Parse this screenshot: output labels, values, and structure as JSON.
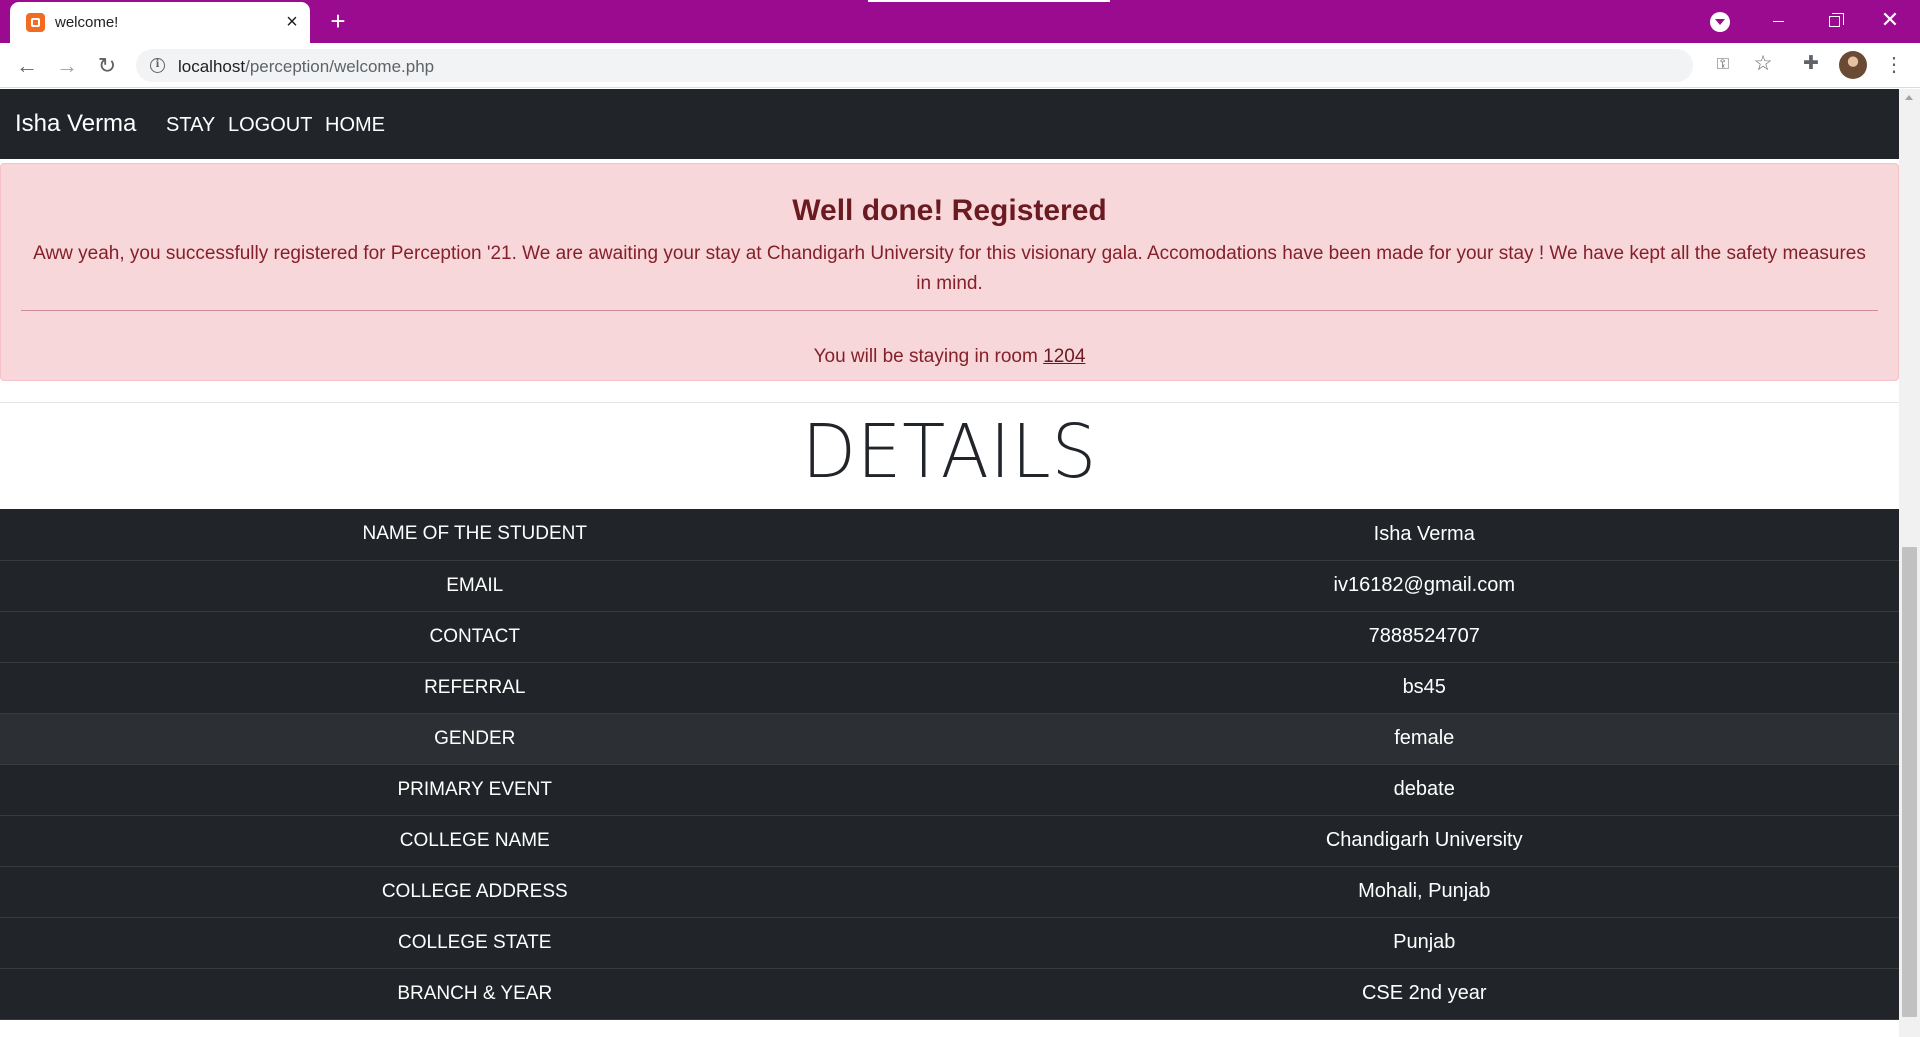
{
  "browser": {
    "tab_title": "welcome!",
    "url_host": "localhost",
    "url_path": "/perception/welcome.php"
  },
  "navbar": {
    "brand": "Isha Verma",
    "links": [
      "STAY",
      "LOGOUT",
      "HOME"
    ]
  },
  "alert": {
    "heading": "Well done! Registered",
    "message": "Aww yeah, you successfully registered for Perception '21. We are awaiting your stay at Chandigarh University for this visionary gala. Accomodations have been made for your stay ! We have kept all the safety measures in mind.",
    "room_prefix": "You will be staying in room",
    "room_number": "1204"
  },
  "details": {
    "heading": "DETAILS",
    "rows": [
      {
        "label": "NAME OF THE STUDENT",
        "value": "Isha Verma"
      },
      {
        "label": "EMAIL",
        "value": "iv16182@gmail.com"
      },
      {
        "label": "CONTACT",
        "value": "7888524707"
      },
      {
        "label": "REFERRAL",
        "value": "bs45"
      },
      {
        "label": "GENDER",
        "value": "female"
      },
      {
        "label": "PRIMARY EVENT",
        "value": "debate"
      },
      {
        "label": "COLLEGE NAME",
        "value": "Chandigarh University"
      },
      {
        "label": "COLLEGE ADDRESS",
        "value": "Mohali, Punjab"
      },
      {
        "label": "COLLEGE STATE",
        "value": "Punjab"
      },
      {
        "label": "BRANCH & YEAR",
        "value": "CSE 2nd year"
      }
    ]
  },
  "colors": {
    "tabstrip": "#9b0b8f",
    "navbar": "#212529",
    "alert_bg": "#f8d7da",
    "alert_text": "#842029"
  },
  "icons": {
    "favicon": "xampp-favicon-icon",
    "back": "arrow-left-icon",
    "forward": "arrow-right-icon",
    "reload": "reload-icon",
    "site_info": "info-icon",
    "password": "key-icon",
    "bookmark": "star-icon",
    "extensions": "puzzle-icon",
    "menu": "kebab-menu-icon"
  }
}
